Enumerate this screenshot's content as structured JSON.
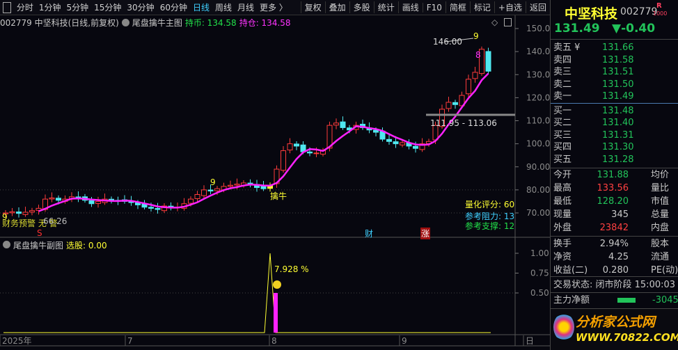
{
  "toolbar": {
    "periods": [
      "分时",
      "1分钟",
      "5分钟",
      "15分钟",
      "30分钟",
      "60分钟",
      "日线",
      "周线",
      "月线",
      "更多 〉"
    ],
    "active": "日线",
    "buttons": [
      "复权",
      "叠加",
      "多股",
      "统计",
      "画线",
      "F10",
      "简框",
      "标记",
      "+自选",
      "返回"
    ]
  },
  "info": {
    "title": "002779 中坚科技(日线,前复权)",
    "indicator": "尾盘擒牛主图",
    "hold_coin": "持币: 134.58",
    "hold_pos": "持仓: 134.58"
  },
  "price_axis": [
    "150.0",
    "140.00",
    "130.00",
    "120.00",
    "110.00",
    "100.00",
    "90.00",
    "80.00",
    "70.00"
  ],
  "annotations": {
    "high": "146.00",
    "nine_top": "9",
    "eight": "8",
    "range": "111.95 - 113.06",
    "nine_mid": "9",
    "buy": "擒牛",
    "nine_low": "9",
    "warn": "财务预警  无  警",
    "low": "66.26",
    "s_mark": "S",
    "cai": "财",
    "zhang": "涨",
    "score": "量化评分: 60",
    "resist": "参考阻力: 13",
    "support": "参考支撑: 12"
  },
  "sub": {
    "indicator": "尾盘擒牛副图",
    "pick": "选股: 0.00",
    "pct": "7.928 %",
    "axis": [
      "1.00",
      "0.75",
      "0.50"
    ]
  },
  "time_axis": [
    "2025年",
    "7",
    "8",
    "9",
    "日"
  ],
  "colors": {
    "up": "#ff3b3b",
    "down": "#4fe8f0",
    "ma": "#ff22ff",
    "yellow": "#ffff33"
  },
  "chart_data": {
    "type": "candlestick",
    "closes": [
      70,
      70.5,
      69.8,
      70.3,
      71,
      72,
      76,
      76.5,
      75.5,
      76,
      77,
      76.5,
      75.5,
      74,
      75,
      76,
      75.5,
      75.2,
      75,
      74.5,
      73.5,
      72.5,
      72,
      71.5,
      73,
      72.5,
      72.5,
      74,
      76,
      78,
      80,
      79.5,
      80.5,
      81.5,
      82,
      82.5,
      83,
      82.5,
      81,
      80.5,
      82,
      89,
      97,
      100,
      99,
      96.5,
      96,
      96,
      97,
      108,
      109,
      107,
      106,
      108,
      107,
      106,
      105,
      102,
      101,
      100,
      100.5,
      99,
      98,
      100,
      101,
      108,
      115,
      118,
      117,
      121,
      128,
      131,
      141,
      131.49
    ],
    "signal_index": 40,
    "ylim": [
      65,
      152
    ]
  },
  "quote": {
    "name": "中坚科技",
    "code": "002779",
    "badge": "R",
    "badge_sub": "1000",
    "price": "131.49",
    "change": "▼-0.40",
    "asks": [
      [
        "卖五 ¥",
        "131.66"
      ],
      [
        "卖四",
        "131.58"
      ],
      [
        "卖三",
        "131.51"
      ],
      [
        "卖二",
        "131.50"
      ],
      [
        "卖一",
        "131.49"
      ]
    ],
    "bids": [
      [
        "买一",
        "131.48"
      ],
      [
        "买二",
        "131.40"
      ],
      [
        "买三",
        "131.31"
      ],
      [
        "买四",
        "131.30"
      ],
      [
        "买五",
        "131.28"
      ]
    ],
    "stats": [
      [
        "今开",
        "131.88",
        "均价",
        "#22c35a"
      ],
      [
        "最高",
        "133.56",
        "量比",
        "#ff4040"
      ],
      [
        "最低",
        "128.20",
        "市值",
        "#22c35a"
      ],
      [
        "现量",
        "345",
        "总量",
        "#c8c8c8"
      ],
      [
        "外盘",
        "23842",
        "内盘",
        "#ff4040"
      ]
    ],
    "stats2": [
      [
        "换手",
        "2.94%",
        "股本"
      ],
      [
        "净资",
        "4.25",
        "流通"
      ],
      [
        "收益(二)",
        "0.280",
        "PE(动)"
      ]
    ],
    "status": "交易状态: 闭市阶段 15:00:03",
    "flow_label": "主力净额",
    "flow_value": "-3045"
  },
  "watermark": {
    "name": "分析家公式网",
    "url": "WWW.70822.COM"
  }
}
